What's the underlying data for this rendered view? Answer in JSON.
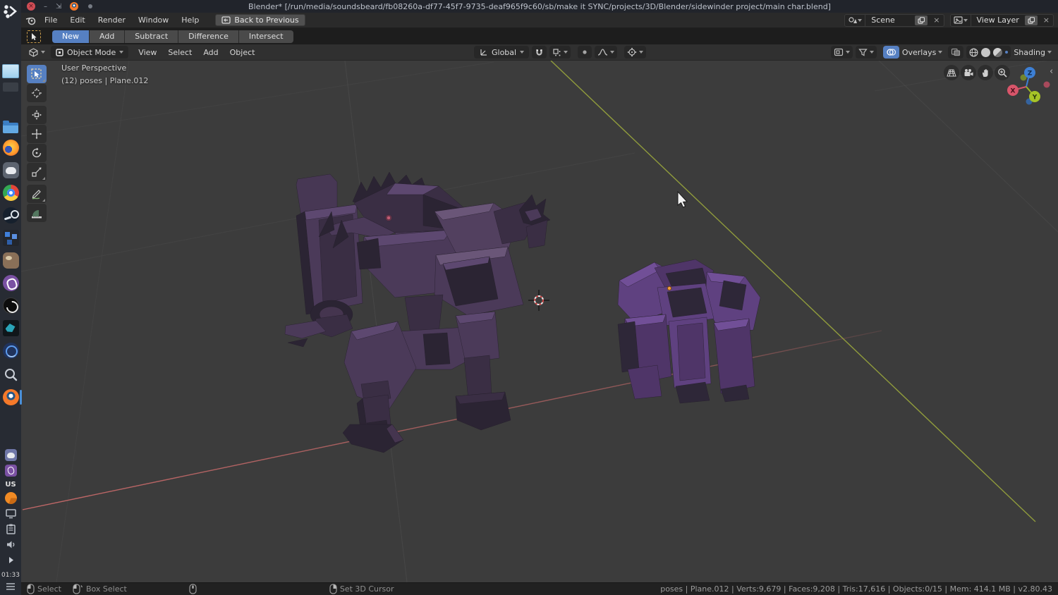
{
  "window_title": "Blender* [/run/media/soundsbeard/fb08260a-df77-45f7-9735-deaf965f9c60/sb/make it SYNC/projects/3D/Blender/sidewinder project/main char.blend]",
  "topbar": {
    "menus": [
      "File",
      "Edit",
      "Render",
      "Window",
      "Help"
    ],
    "back_button": "Back to Previous",
    "scene_selector": {
      "value": "Scene"
    },
    "view_layer_selector": {
      "value": "View Layer"
    }
  },
  "tool_settings": {
    "modes": [
      "New",
      "Add",
      "Subtract",
      "Difference",
      "Intersect"
    ],
    "active_mode": "New"
  },
  "viewport_header": {
    "mode": "Object Mode",
    "menus": [
      "View",
      "Select",
      "Add",
      "Object"
    ],
    "orientation": "Global",
    "overlays_label": "Overlays",
    "shading_label": "Shading"
  },
  "viewport": {
    "view_label": "User Perspective",
    "breadcrumb": "(12) poses | Plane.012",
    "axis_labels": {
      "x": "X",
      "y": "Y",
      "z": "Z"
    }
  },
  "toolbar_tools": [
    "select-box",
    "cursor",
    "transform",
    "move",
    "rotate",
    "scale",
    "annotate",
    "measure"
  ],
  "status_bar": {
    "hints": [
      {
        "icon": "mouse-left",
        "label": "Select"
      },
      {
        "icon": "mouse-left-drag",
        "label": "Box Select"
      },
      {
        "icon": "mouse-middle",
        "label": ""
      },
      {
        "icon": "mouse-right",
        "label": "Set 3D Cursor"
      }
    ],
    "stats": "poses | Plane.012 | Verts:9,679 | Faces:9,208 | Tris:17,616 | Objects:0/15 | Mem: 414.1 MB | v2.80.43"
  },
  "dock": {
    "items": [
      "workspace-switcher",
      "window-thumbnail",
      "window-thumbnail-dim",
      "file-manager",
      "firefox",
      "discord",
      "chrome",
      "steam",
      "retro-game",
      "gimp",
      "viber",
      "obs-studio",
      "teal-app",
      "blue-app",
      "search",
      "blender"
    ],
    "tray": [
      "discord",
      "viber",
      "keyboard-layout",
      "copyq",
      "display",
      "clipboard",
      "volume",
      "expand"
    ],
    "keyboard_layout": "US",
    "clock": "01:33"
  },
  "colors": {
    "accent": "#5680c2",
    "axis_x": "#c96a6a",
    "axis_y": "#9aa73c",
    "axis_z": "#3d7fd4",
    "viewport_bg": "#3c3c3c",
    "robot_main": "#4b3a59",
    "robot_second": "#5f4180",
    "origin_dot": "#f29f3c"
  }
}
